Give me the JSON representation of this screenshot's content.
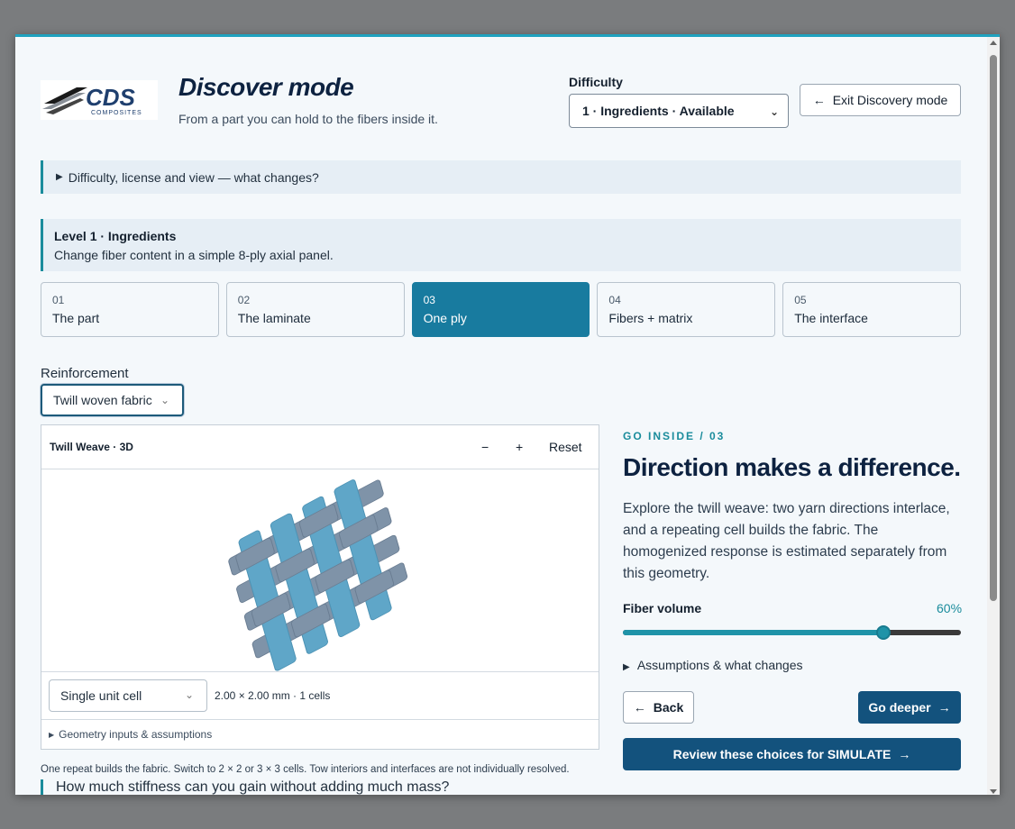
{
  "header": {
    "logo_text": "CDS",
    "logo_subtext": "COMPOSITES",
    "title": "Discover mode",
    "subtitle": "From a part you can hold to the fibers inside it.",
    "difficulty_label": "Difficulty",
    "difficulty_value": "1 · Ingredients · Available",
    "exit_label": "Exit Discovery mode"
  },
  "info_bar": {
    "label": "Difficulty, license and view — what changes?"
  },
  "level": {
    "title": "Level 1 · Ingredients",
    "description": "Change fiber content in a simple 8-ply axial panel."
  },
  "steps": [
    {
      "num": "01",
      "label": "The part",
      "active": false
    },
    {
      "num": "02",
      "label": "The laminate",
      "active": false
    },
    {
      "num": "03",
      "label": "One ply",
      "active": true
    },
    {
      "num": "04",
      "label": "Fibers + matrix",
      "active": false
    },
    {
      "num": "05",
      "label": "The interface",
      "active": false
    }
  ],
  "reinforcement": {
    "label": "Reinforcement",
    "value": "Twill woven fabric"
  },
  "viewer": {
    "title": "Twill Weave · 3D",
    "zoom_out": "−",
    "zoom_in": "+",
    "reset": "Reset",
    "cells_value": "Single unit cell",
    "dims": "2.00 × 2.00 mm · 1 cells",
    "geometry_label": "Geometry inputs & assumptions",
    "colors": {
      "warp": "#5fa6c8",
      "weft": "#7f93a8"
    }
  },
  "note": "One repeat builds the fabric. Switch to 2 × 2 or 3 × 3 cells. Tow interiors and interfaces are not individually resolved.",
  "question": "How much stiffness can you gain without adding much mass?",
  "panel": {
    "kicker": "GO INSIDE / 03",
    "title": "Direction makes a difference.",
    "body": "Explore the twill weave: two yarn directions interlace, and a repeating cell builds the fabric. The homogenized response is estimated separately from this geometry.",
    "fiber_volume_label": "Fiber volume",
    "fiber_volume_value": "60%",
    "fiber_volume_fraction": 0.77,
    "assumptions_label": "Assumptions & what changes",
    "back_label": "Back",
    "deeper_label": "Go deeper",
    "review_label": "Review these choices for SIMULATE"
  },
  "accent_color": "#187b9f",
  "brand_color": "#13527d"
}
